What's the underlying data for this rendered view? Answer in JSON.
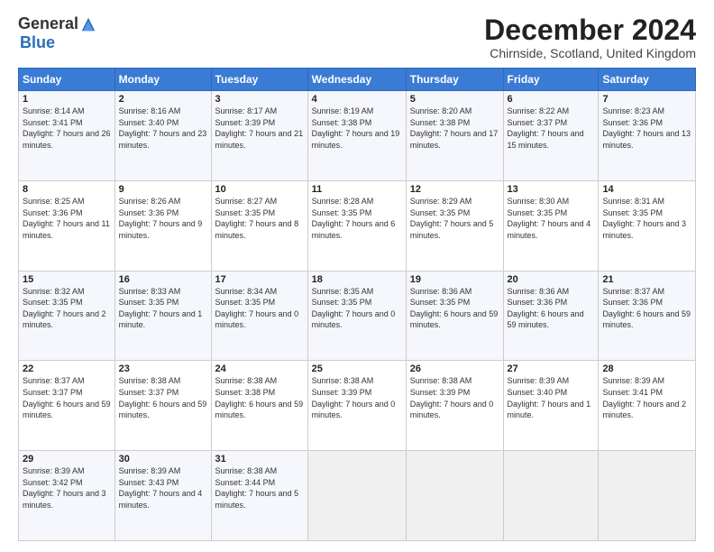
{
  "logo": {
    "general": "General",
    "blue": "Blue"
  },
  "header": {
    "month_title": "December 2024",
    "location": "Chirnside, Scotland, United Kingdom"
  },
  "days_of_week": [
    "Sunday",
    "Monday",
    "Tuesday",
    "Wednesday",
    "Thursday",
    "Friday",
    "Saturday"
  ],
  "weeks": [
    [
      {
        "day": "1",
        "sunrise": "Sunrise: 8:14 AM",
        "sunset": "Sunset: 3:41 PM",
        "daylight": "Daylight: 7 hours and 26 minutes."
      },
      {
        "day": "2",
        "sunrise": "Sunrise: 8:16 AM",
        "sunset": "Sunset: 3:40 PM",
        "daylight": "Daylight: 7 hours and 23 minutes."
      },
      {
        "day": "3",
        "sunrise": "Sunrise: 8:17 AM",
        "sunset": "Sunset: 3:39 PM",
        "daylight": "Daylight: 7 hours and 21 minutes."
      },
      {
        "day": "4",
        "sunrise": "Sunrise: 8:19 AM",
        "sunset": "Sunset: 3:38 PM",
        "daylight": "Daylight: 7 hours and 19 minutes."
      },
      {
        "day": "5",
        "sunrise": "Sunrise: 8:20 AM",
        "sunset": "Sunset: 3:38 PM",
        "daylight": "Daylight: 7 hours and 17 minutes."
      },
      {
        "day": "6",
        "sunrise": "Sunrise: 8:22 AM",
        "sunset": "Sunset: 3:37 PM",
        "daylight": "Daylight: 7 hours and 15 minutes."
      },
      {
        "day": "7",
        "sunrise": "Sunrise: 8:23 AM",
        "sunset": "Sunset: 3:36 PM",
        "daylight": "Daylight: 7 hours and 13 minutes."
      }
    ],
    [
      {
        "day": "8",
        "sunrise": "Sunrise: 8:25 AM",
        "sunset": "Sunset: 3:36 PM",
        "daylight": "Daylight: 7 hours and 11 minutes."
      },
      {
        "day": "9",
        "sunrise": "Sunrise: 8:26 AM",
        "sunset": "Sunset: 3:36 PM",
        "daylight": "Daylight: 7 hours and 9 minutes."
      },
      {
        "day": "10",
        "sunrise": "Sunrise: 8:27 AM",
        "sunset": "Sunset: 3:35 PM",
        "daylight": "Daylight: 7 hours and 8 minutes."
      },
      {
        "day": "11",
        "sunrise": "Sunrise: 8:28 AM",
        "sunset": "Sunset: 3:35 PM",
        "daylight": "Daylight: 7 hours and 6 minutes."
      },
      {
        "day": "12",
        "sunrise": "Sunrise: 8:29 AM",
        "sunset": "Sunset: 3:35 PM",
        "daylight": "Daylight: 7 hours and 5 minutes."
      },
      {
        "day": "13",
        "sunrise": "Sunrise: 8:30 AM",
        "sunset": "Sunset: 3:35 PM",
        "daylight": "Daylight: 7 hours and 4 minutes."
      },
      {
        "day": "14",
        "sunrise": "Sunrise: 8:31 AM",
        "sunset": "Sunset: 3:35 PM",
        "daylight": "Daylight: 7 hours and 3 minutes."
      }
    ],
    [
      {
        "day": "15",
        "sunrise": "Sunrise: 8:32 AM",
        "sunset": "Sunset: 3:35 PM",
        "daylight": "Daylight: 7 hours and 2 minutes."
      },
      {
        "day": "16",
        "sunrise": "Sunrise: 8:33 AM",
        "sunset": "Sunset: 3:35 PM",
        "daylight": "Daylight: 7 hours and 1 minute."
      },
      {
        "day": "17",
        "sunrise": "Sunrise: 8:34 AM",
        "sunset": "Sunset: 3:35 PM",
        "daylight": "Daylight: 7 hours and 0 minutes."
      },
      {
        "day": "18",
        "sunrise": "Sunrise: 8:35 AM",
        "sunset": "Sunset: 3:35 PM",
        "daylight": "Daylight: 7 hours and 0 minutes."
      },
      {
        "day": "19",
        "sunrise": "Sunrise: 8:36 AM",
        "sunset": "Sunset: 3:35 PM",
        "daylight": "Daylight: 6 hours and 59 minutes."
      },
      {
        "day": "20",
        "sunrise": "Sunrise: 8:36 AM",
        "sunset": "Sunset: 3:36 PM",
        "daylight": "Daylight: 6 hours and 59 minutes."
      },
      {
        "day": "21",
        "sunrise": "Sunrise: 8:37 AM",
        "sunset": "Sunset: 3:36 PM",
        "daylight": "Daylight: 6 hours and 59 minutes."
      }
    ],
    [
      {
        "day": "22",
        "sunrise": "Sunrise: 8:37 AM",
        "sunset": "Sunset: 3:37 PM",
        "daylight": "Daylight: 6 hours and 59 minutes."
      },
      {
        "day": "23",
        "sunrise": "Sunrise: 8:38 AM",
        "sunset": "Sunset: 3:37 PM",
        "daylight": "Daylight: 6 hours and 59 minutes."
      },
      {
        "day": "24",
        "sunrise": "Sunrise: 8:38 AM",
        "sunset": "Sunset: 3:38 PM",
        "daylight": "Daylight: 6 hours and 59 minutes."
      },
      {
        "day": "25",
        "sunrise": "Sunrise: 8:38 AM",
        "sunset": "Sunset: 3:39 PM",
        "daylight": "Daylight: 7 hours and 0 minutes."
      },
      {
        "day": "26",
        "sunrise": "Sunrise: 8:38 AM",
        "sunset": "Sunset: 3:39 PM",
        "daylight": "Daylight: 7 hours and 0 minutes."
      },
      {
        "day": "27",
        "sunrise": "Sunrise: 8:39 AM",
        "sunset": "Sunset: 3:40 PM",
        "daylight": "Daylight: 7 hours and 1 minute."
      },
      {
        "day": "28",
        "sunrise": "Sunrise: 8:39 AM",
        "sunset": "Sunset: 3:41 PM",
        "daylight": "Daylight: 7 hours and 2 minutes."
      }
    ],
    [
      {
        "day": "29",
        "sunrise": "Sunrise: 8:39 AM",
        "sunset": "Sunset: 3:42 PM",
        "daylight": "Daylight: 7 hours and 3 minutes."
      },
      {
        "day": "30",
        "sunrise": "Sunrise: 8:39 AM",
        "sunset": "Sunset: 3:43 PM",
        "daylight": "Daylight: 7 hours and 4 minutes."
      },
      {
        "day": "31",
        "sunrise": "Sunrise: 8:38 AM",
        "sunset": "Sunset: 3:44 PM",
        "daylight": "Daylight: 7 hours and 5 minutes."
      },
      null,
      null,
      null,
      null
    ]
  ]
}
